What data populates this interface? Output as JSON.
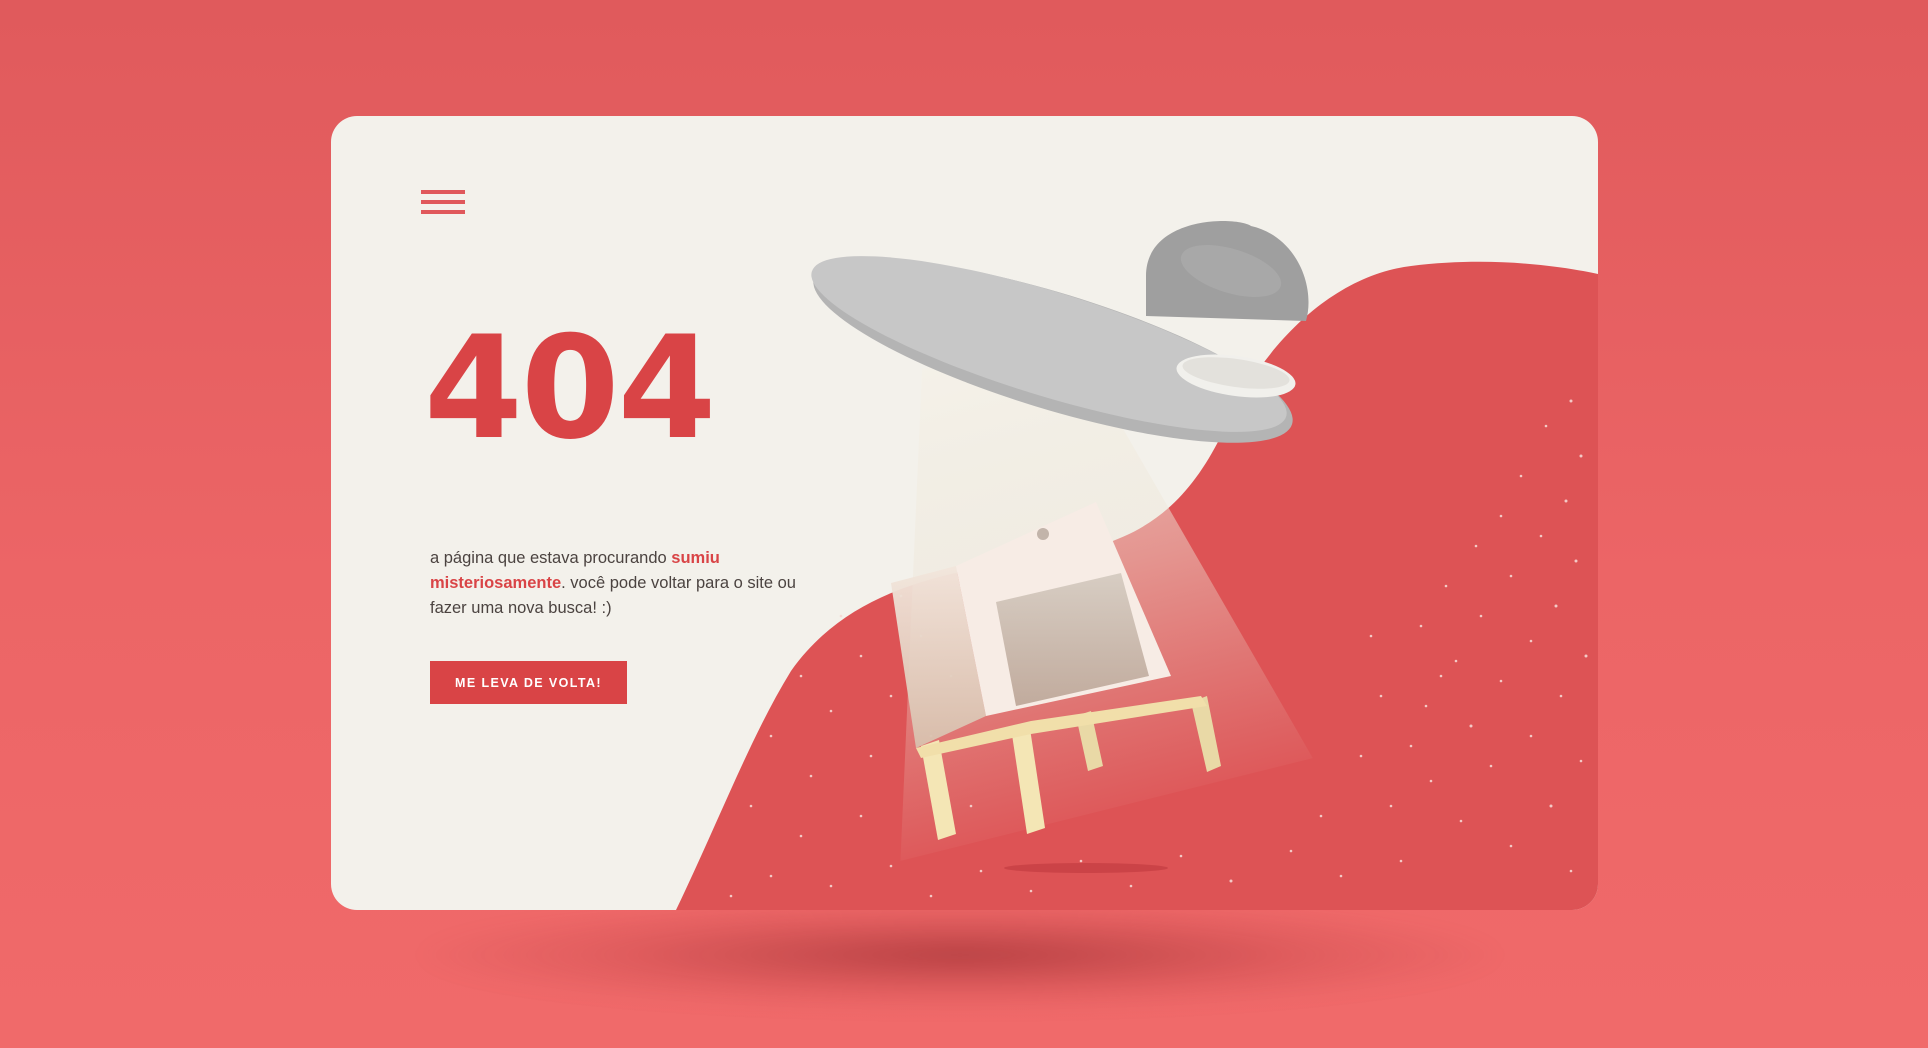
{
  "page": {
    "background_color": "#e85f60",
    "card_color": "#f3f1eb",
    "accent_color": "#d94446"
  },
  "header": {
    "menu_icon": "hamburger-menu-icon"
  },
  "error": {
    "code": "404",
    "message_before": "a página que estava procurando ",
    "message_highlight": "sumiu misteriosamente",
    "message_after": ". você pode voltar para o site ou fazer uma nova busca! :)"
  },
  "actions": {
    "back_label": "me leva de volta!"
  },
  "illustration": {
    "description_icons": [
      "ufo-icon",
      "tractor-beam",
      "nightstand-icon",
      "stars"
    ]
  }
}
